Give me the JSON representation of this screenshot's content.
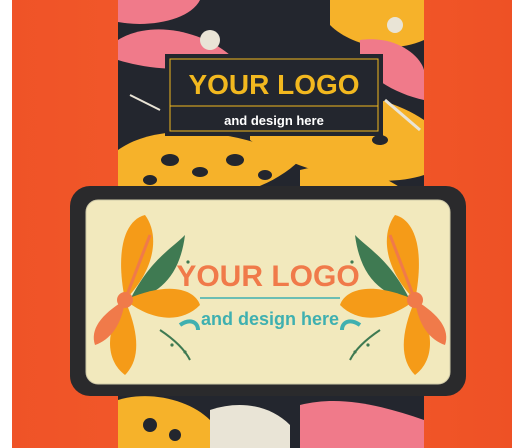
{
  "top_label": {
    "title": "YOUR LOGO",
    "subtitle": "and design here"
  },
  "window_label": {
    "title": "YOUR LOGO",
    "subtitle": "and design here"
  },
  "colors": {
    "box_orange": "#f2582a",
    "band_dark": "#23262e",
    "pattern_yellow": "#f6b22a",
    "pattern_pink": "#f07a8a",
    "window_frame": "#2a2a2c",
    "window_insert": "#f2e9bd",
    "flower_orange": "#f59b18",
    "leaf_green": "#3f7a52",
    "logo_orange": "#f07a4a",
    "logo_teal": "#3fb0b0"
  },
  "icons": [
    "flower-left-icon",
    "flower-right-icon"
  ]
}
